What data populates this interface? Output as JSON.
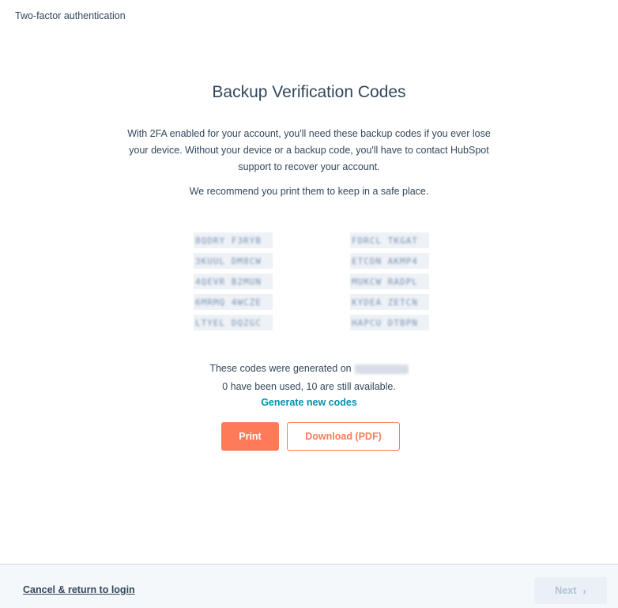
{
  "header": {
    "title": "Two-factor authentication"
  },
  "main": {
    "heading": "Backup Verification Codes",
    "description": "With 2FA enabled for your account, you'll need these backup codes if you ever lose your device. Without your device or a backup code, you'll have to contact HubSpot support to recover your account.",
    "recommendation": "We recommend you print them to keep in a safe place.",
    "codes": {
      "left": [
        "8QDRY F3RYB",
        "3KUUL DM8CW",
        "4QEVR B2MUN",
        "6MRMQ 4WCZE",
        "LTYEL DQZGC"
      ],
      "right": [
        "FDRCL TKGAT",
        "ETCDN AKMP4",
        "MUKCW RADPL",
        "KYDEA ZETCN",
        "HAPCU DTBPN"
      ]
    },
    "generated_prefix": "These codes were generated on",
    "usage": "0 have been used, 10 are still available.",
    "generate_link": "Generate new codes",
    "print_label": "Print",
    "download_label": "Download (PDF)"
  },
  "footer": {
    "cancel_label": "Cancel & return to login",
    "next_label": "Next",
    "next_icon": "chevron-right-icon"
  },
  "colors": {
    "accent": "#ff7a59",
    "link": "#0091ae",
    "text": "#33475b",
    "footer_bg": "#f5f8fa",
    "disabled": "#b0c1d4"
  }
}
